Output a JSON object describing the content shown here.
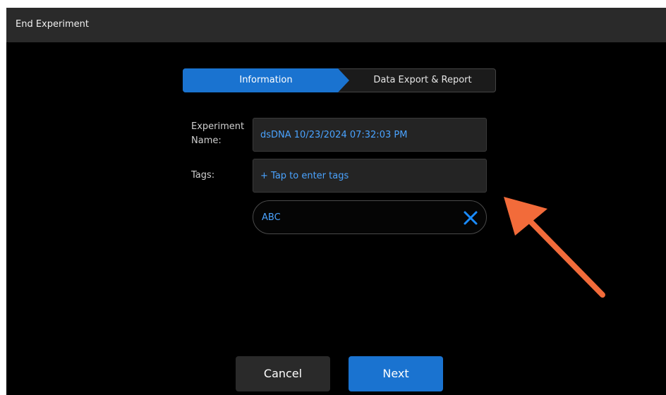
{
  "window": {
    "title": "End Experiment"
  },
  "stepper": {
    "steps": [
      {
        "label": "Information",
        "active": true
      },
      {
        "label": "Data Export & Report",
        "active": false
      }
    ]
  },
  "form": {
    "experiment_name": {
      "label": "Experiment\nName:",
      "value": "dsDNA 10/23/2024 07:32:03 PM"
    },
    "tags": {
      "label": "Tags:",
      "placeholder": "+ Tap to enter tags",
      "items": [
        "ABC"
      ]
    }
  },
  "buttons": {
    "cancel": "Cancel",
    "next": "Next"
  },
  "colors": {
    "accent": "#1a73d0",
    "link_text": "#4aa3ff",
    "annotation_arrow": "#f26b3a"
  },
  "icons": {
    "tag_remove": "close-icon",
    "annotation": "arrow-icon"
  }
}
